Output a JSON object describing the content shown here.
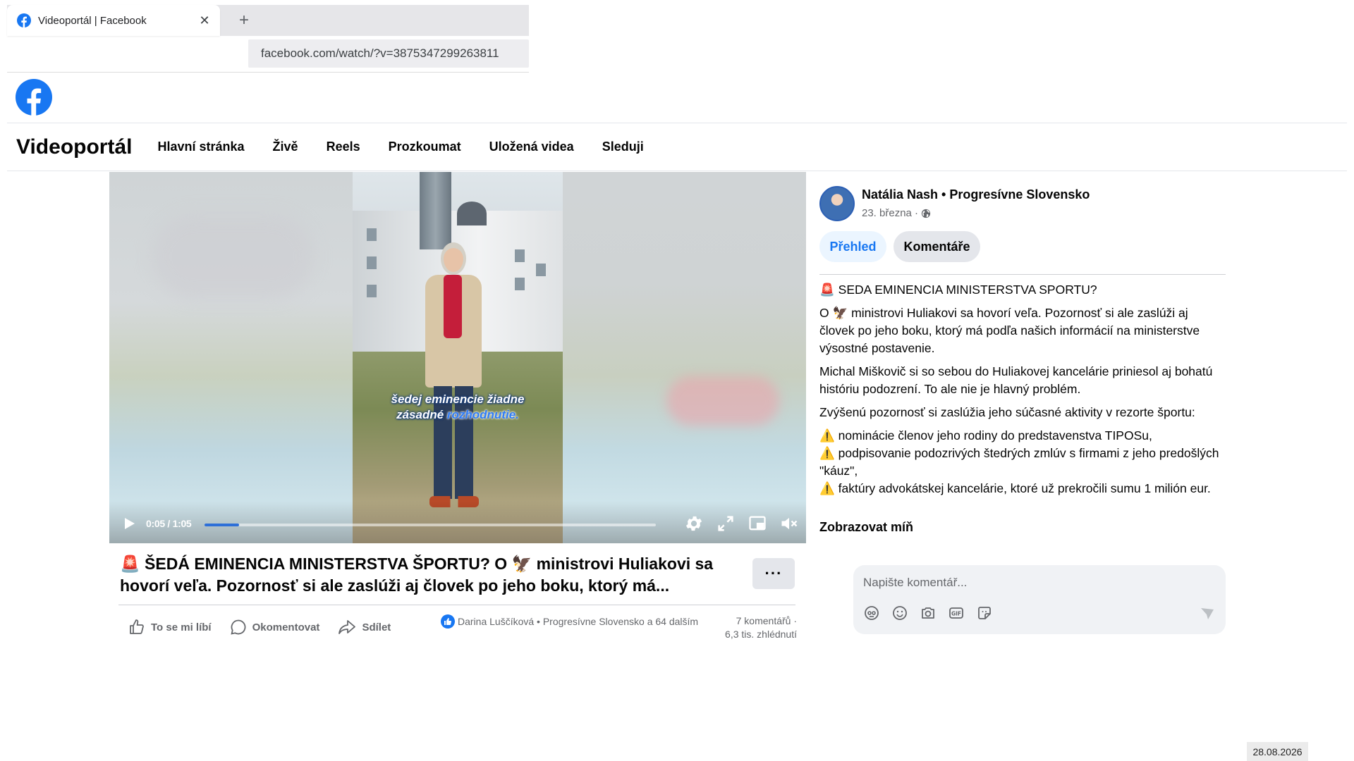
{
  "browser": {
    "tab_title": "Videoportál | Facebook",
    "tab_close": "✕",
    "new_tab": "+",
    "url": "facebook.com/watch/?v=3875347299263811"
  },
  "nav": {
    "title": "Videoportál",
    "items": [
      "Hlavní stránka",
      "Živě",
      "Reels",
      "Prozkoumat",
      "Uložená videa",
      "Sleduji"
    ]
  },
  "video": {
    "caption_line1": "šedej eminencie žiadne",
    "caption_line2_a": "zásadné ",
    "caption_line2_b": "rozhodnutie.",
    "current_time": "0:05",
    "duration": "1:05",
    "time_display": "0:05 / 1:05",
    "progress_fraction": 0.077
  },
  "post": {
    "title": "🚨 ŠEDÁ EMINENCIA MINISTERSTVA ŠPORTU? O 🦅 ministrovi Huliakovi sa hovorí veľa. Pozornosť si ale zaslúži aj človek po jeho boku, ktorý má...",
    "more": "···",
    "actions": {
      "like": "To se mi líbí",
      "comment": "Okomentovat",
      "share": "Sdílet"
    },
    "reactions_text": "Darina Luščíková • Progresívne Slovensko a 64 dalším",
    "comments_count": "7 komentářů ·",
    "views": "6,3 tis. zhlédnutí"
  },
  "panel": {
    "author": "Natália Nash • Progresívne Slovensko",
    "date": "23. března ·",
    "tab_overview": "Přehled",
    "tab_comments": "Komentáře",
    "desc": {
      "p1": "🚨 SEDA EMINENCIA MINISTERSTVA SPORTU?",
      "p2": "O 🦅 ministrovi Huliakovi sa hovorí veľa. Pozornosť si ale zaslúži aj človek po jeho boku, ktorý má podľa našich informácií na ministerstve výsostné postavenie.",
      "p3": "Michal Miškovič si so sebou do Huliakovej kancelárie priniesol aj bohatú históriu podozrení. To ale nie je hlavný problém.",
      "p4": "Zvýšenú pozornosť si zaslúžia jeho súčasné aktivity v rezorte športu:",
      "b1": "⚠️ nominácie členov jeho rodiny do predstavenstva TIPOSu,",
      "b2": "⚠️ podpisovanie podozrivých štedrých zmlúv s firmami z jeho predošlých \"káuz\",",
      "b3": "⚠️ faktúry advokátskej kancelárie, ktoré už prekročili sumu 1 milión eur."
    },
    "show_less": "Zobrazovat míň",
    "comment_placeholder": "Napište komentář..."
  },
  "system": {
    "date": "28.08.2026"
  },
  "colors": {
    "brand": "#1877f2",
    "text": "#050505",
    "secondary": "#65676b"
  }
}
